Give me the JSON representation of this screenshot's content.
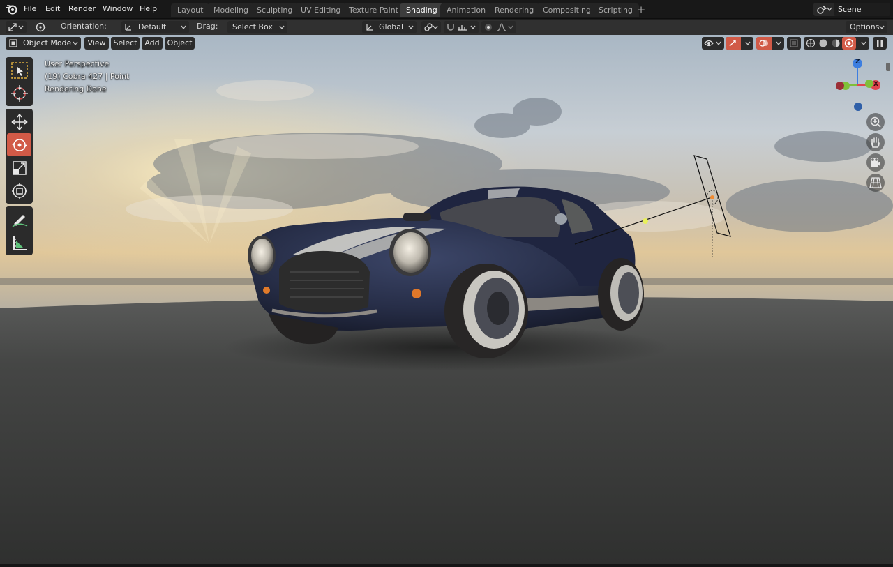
{
  "menu": {
    "items": [
      "File",
      "Edit",
      "Render",
      "Window",
      "Help"
    ]
  },
  "workspaces": {
    "tabs": [
      "Layout",
      "Modeling",
      "Sculpting",
      "UV Editing",
      "Texture Paint",
      "Shading",
      "Animation",
      "Rendering",
      "Compositing",
      "Scripting"
    ],
    "active": "Shading"
  },
  "scene": {
    "name": "Scene"
  },
  "tool_header": {
    "orientation_label": "Orientation:",
    "orientation_value": "Default",
    "drag_label": "Drag:",
    "drag_value": "Select Box",
    "transform_orientation": "Global",
    "options_label": "Options"
  },
  "viewport": {
    "mode": "Object Mode",
    "menus": [
      "View",
      "Select",
      "Add",
      "Object"
    ],
    "overlay_lines": [
      "User Perspective",
      "(19) Cobra 427 | Point",
      "Rendering Done"
    ],
    "gizmo_axes": {
      "z": "Z",
      "x": "X"
    }
  },
  "colors": {
    "active_tool": "#d15a47",
    "axis_x": "#e0454f",
    "axis_y": "#7fbf3a",
    "axis_z": "#3d7ee0",
    "light_gizmo": "#e8f05a"
  },
  "icons": {
    "toolbar": [
      "select-box-icon",
      "cursor-icon",
      "move-icon",
      "rotate-icon",
      "scale-icon",
      "transform-icon",
      "annotate-icon",
      "measure-icon"
    ],
    "navigation": [
      "zoom-icon",
      "pan-hand-icon",
      "camera-view-icon",
      "ortho-grid-icon"
    ]
  }
}
